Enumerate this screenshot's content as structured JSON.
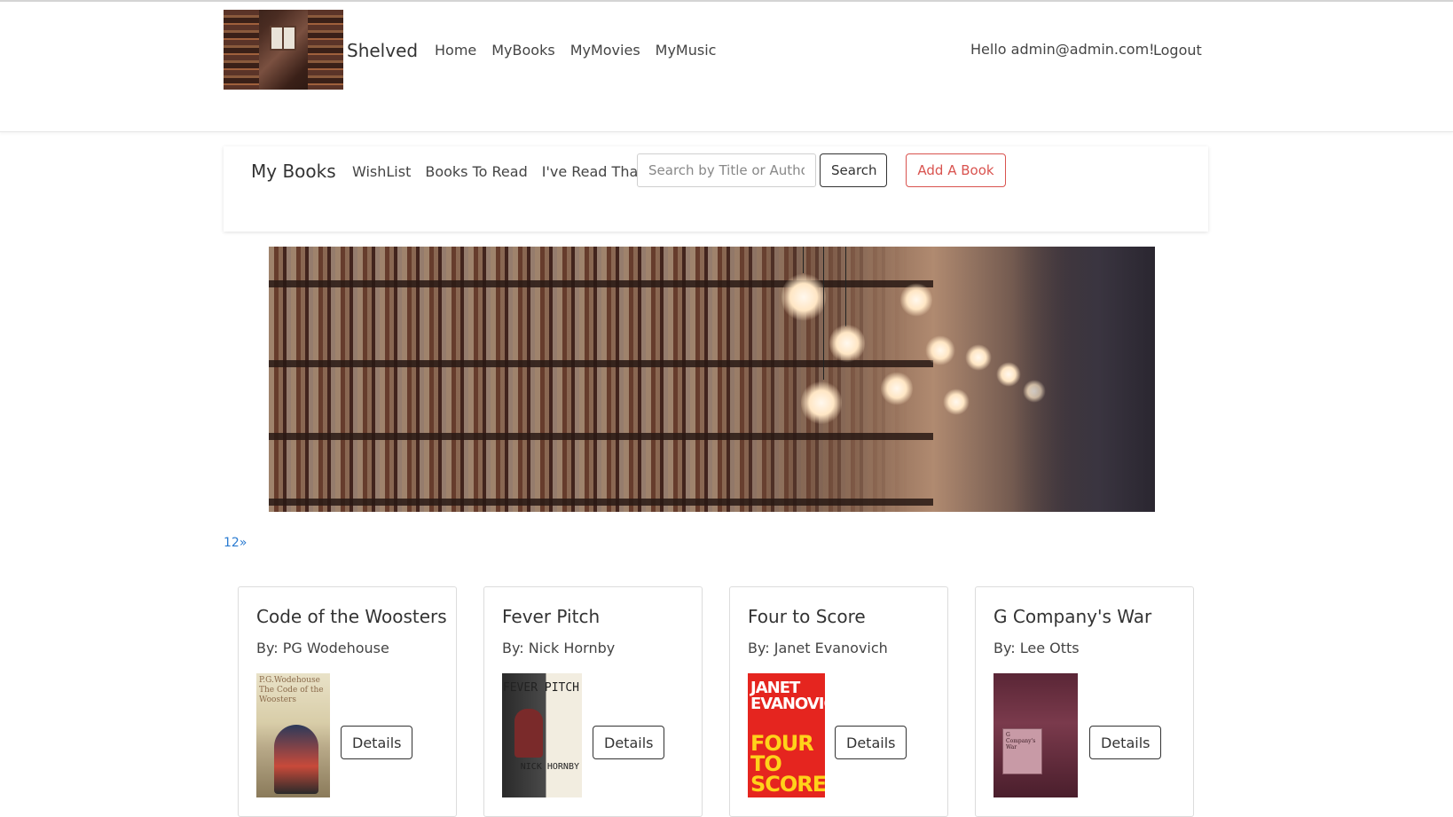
{
  "header": {
    "brand": "Shelved",
    "nav": [
      "Home",
      "MyBooks",
      "MyMovies",
      "MyMusic"
    ],
    "greeting": "Hello admin@admin.com!",
    "logout": "Logout"
  },
  "subnav": {
    "title": "My Books",
    "links": [
      "WishList",
      "Books To Read",
      "I've Read That"
    ],
    "search_placeholder": "Search by Title or Author",
    "search_button": "Search",
    "add_button": "Add A Book"
  },
  "pager": {
    "pages": [
      "1",
      "2"
    ],
    "next": "»"
  },
  "books": [
    {
      "title": "Code of the Woosters",
      "author": "By: PG Wodehouse",
      "cover_text": "P.G.Wodehouse The Code of the Woosters",
      "details": "Details"
    },
    {
      "title": "Fever Pitch",
      "author": "By: Nick Hornby",
      "cover_text": "FEVER PITCH",
      "cover_author": "NICK HORNBY",
      "details": "Details"
    },
    {
      "title": "Four to Score",
      "author": "By: Janet Evanovich",
      "cover_text": "JANET EVANOVICH",
      "cover_sub": "FOUR TO SCORE",
      "details": "Details"
    },
    {
      "title": "G Company's War",
      "author": "By: Lee Otts",
      "cover_text": "G Company's War",
      "details": "Details"
    }
  ],
  "colors": {
    "accent_red": "#d9534f",
    "link_blue": "#2a7bd1"
  }
}
